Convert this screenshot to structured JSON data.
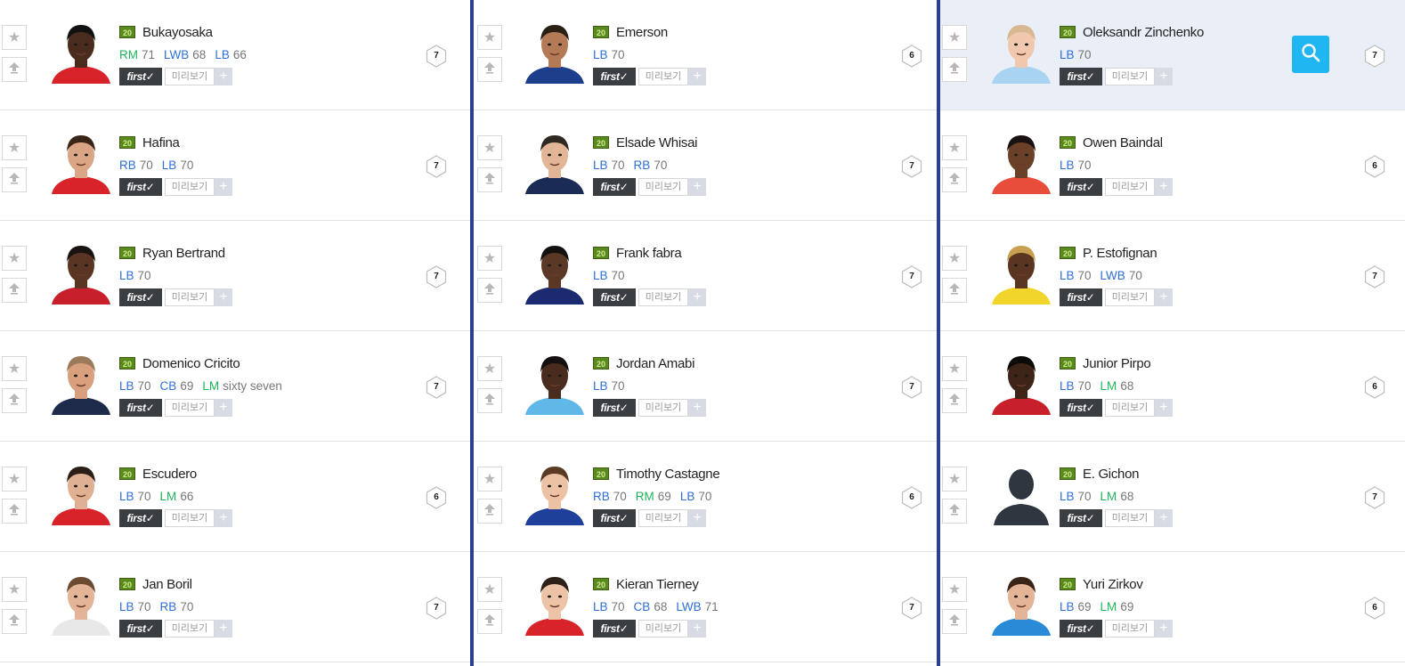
{
  "ui": {
    "season_label": "20",
    "first_label": "first✓",
    "preview_label": "미리보기",
    "plus_label": "+",
    "star_glyph": "★"
  },
  "colors": {
    "divider": "#2b3f8f",
    "highlight_bg": "#e9eef7",
    "search_button": "#1fb6f2",
    "position_blue": "#2f6fd6",
    "position_green": "#1eb35a"
  },
  "columns": [
    {
      "players": [
        {
          "name": "Bukayosaka",
          "grade": "7",
          "positions": [
            {
              "pos": "RM",
              "color": "green",
              "ovr": "71"
            },
            {
              "pos": "LWB",
              "color": "blue",
              "ovr": "68"
            },
            {
              "pos": "LB",
              "color": "blue",
              "ovr": "66"
            }
          ],
          "face": {
            "skin": "#4a2c1c",
            "hair": "#111",
            "shirt": "#d9232a",
            "bg": "#fff"
          }
        },
        {
          "name": "Hafina",
          "grade": "7",
          "positions": [
            {
              "pos": "RB",
              "color": "blue",
              "ovr": "70"
            },
            {
              "pos": "LB",
              "color": "blue",
              "ovr": "70"
            }
          ],
          "face": {
            "skin": "#d9a585",
            "hair": "#3a2418",
            "shirt": "#d9232a",
            "bg": "#fff"
          }
        },
        {
          "name": "Ryan Bertrand",
          "grade": "7",
          "positions": [
            {
              "pos": "LB",
              "color": "blue",
              "ovr": "70"
            }
          ],
          "face": {
            "skin": "#5a3524",
            "hair": "#1a1210",
            "shirt": "#c8202a",
            "bg": "#fff"
          }
        },
        {
          "name": "Domenico Cricito",
          "grade": "7",
          "positions": [
            {
              "pos": "LB",
              "color": "blue",
              "ovr": "70"
            },
            {
              "pos": "CB",
              "color": "blue",
              "ovr": "69"
            },
            {
              "pos": "LM",
              "color": "green",
              "ovr": "sixty seven"
            }
          ],
          "face": {
            "skin": "#d8a07c",
            "hair": "#9a7a5a",
            "shirt": "#1e2a4a",
            "bg": "#fff"
          }
        },
        {
          "name": "Escudero",
          "grade": "6",
          "positions": [
            {
              "pos": "LB",
              "color": "blue",
              "ovr": "70"
            },
            {
              "pos": "LM",
              "color": "green",
              "ovr": "66"
            }
          ],
          "face": {
            "skin": "#e0b093",
            "hair": "#2a1e16",
            "shirt": "#d9232a",
            "bg": "#fff"
          }
        },
        {
          "name": "Jan Boril",
          "grade": "7",
          "positions": [
            {
              "pos": "LB",
              "color": "blue",
              "ovr": "70"
            },
            {
              "pos": "RB",
              "color": "blue",
              "ovr": "70"
            }
          ],
          "face": {
            "skin": "#e3b596",
            "hair": "#6b4a32",
            "shirt": "#e8e8e8",
            "bg": "#fff"
          }
        }
      ]
    },
    {
      "players": [
        {
          "name": "Emerson",
          "grade": "6",
          "positions": [
            {
              "pos": "LB",
              "color": "blue",
              "ovr": "70"
            }
          ],
          "face": {
            "skin": "#b47a55",
            "hair": "#2b2016",
            "shirt": "#1d3e8a",
            "bg": "#fff"
          }
        },
        {
          "name": "Elsade Whisai",
          "grade": "7",
          "positions": [
            {
              "pos": "LB",
              "color": "blue",
              "ovr": "70"
            },
            {
              "pos": "RB",
              "color": "blue",
              "ovr": "70"
            }
          ],
          "face": {
            "skin": "#e2b597",
            "hair": "#2f2922",
            "shirt": "#1a2b55",
            "bg": "#fff"
          }
        },
        {
          "name": "Frank fabra",
          "grade": "7",
          "positions": [
            {
              "pos": "LB",
              "color": "blue",
              "ovr": "70"
            }
          ],
          "face": {
            "skin": "#5b3826",
            "hair": "#141010",
            "shirt": "#1a2b70",
            "bg": "#fff"
          }
        },
        {
          "name": "Jordan Amabi",
          "grade": "7",
          "positions": [
            {
              "pos": "LB",
              "color": "blue",
              "ovr": "70"
            }
          ],
          "face": {
            "skin": "#4a2c1e",
            "hair": "#141010",
            "shirt": "#5fb8e8",
            "bg": "#fff"
          }
        },
        {
          "name": "Timothy Castagne",
          "grade": "6",
          "positions": [
            {
              "pos": "RB",
              "color": "blue",
              "ovr": "70"
            },
            {
              "pos": "RM",
              "color": "green",
              "ovr": "69"
            },
            {
              "pos": "LB",
              "color": "blue",
              "ovr": "70"
            }
          ],
          "face": {
            "skin": "#ecc2a5",
            "hair": "#5a3a22",
            "shirt": "#1e3f9a",
            "bg": "#fff"
          }
        },
        {
          "name": "Kieran Tierney",
          "grade": "7",
          "positions": [
            {
              "pos": "LB",
              "color": "blue",
              "ovr": "70"
            },
            {
              "pos": "CB",
              "color": "blue",
              "ovr": "68"
            },
            {
              "pos": "LWB",
              "color": "blue",
              "ovr": "71"
            }
          ],
          "face": {
            "skin": "#ecc3a6",
            "hair": "#2e2018",
            "shirt": "#d9232a",
            "bg": "#fff"
          }
        }
      ]
    },
    {
      "players": [
        {
          "name": "Oleksandr Zinchenko",
          "grade": "7",
          "highlight": true,
          "positions": [
            {
              "pos": "LB",
              "color": "blue",
              "ovr": "70"
            }
          ],
          "face": {
            "skin": "#f0c8ad",
            "hair": "#d8b890",
            "shirt": "#a8d4f2",
            "bg": "#e9eef7"
          }
        },
        {
          "name": "Owen Baindal",
          "grade": "6",
          "positions": [
            {
              "pos": "LB",
              "color": "blue",
              "ovr": "70"
            }
          ],
          "face": {
            "skin": "#6b4028",
            "hair": "#1a1210",
            "shirt": "#e84c3a",
            "bg": "#fff"
          }
        },
        {
          "name": "P. Estofignan",
          "grade": "7",
          "positions": [
            {
              "pos": "LB",
              "color": "blue",
              "ovr": "70"
            },
            {
              "pos": "LWB",
              "color": "blue",
              "ovr": "70"
            }
          ],
          "face": {
            "skin": "#5a3522",
            "hair": "#c9a050",
            "shirt": "#f2d52a",
            "bg": "#fff"
          }
        },
        {
          "name": "Junior Pirpo",
          "grade": "6",
          "positions": [
            {
              "pos": "LB",
              "color": "blue",
              "ovr": "70"
            },
            {
              "pos": "LM",
              "color": "green",
              "ovr": "68"
            }
          ],
          "face": {
            "skin": "#3e2418",
            "hair": "#0e0a08",
            "shirt": "#c8202a",
            "bg": "#fff"
          }
        },
        {
          "name": "E. Gichon",
          "grade": "7",
          "silhouette": true,
          "positions": [
            {
              "pos": "LB",
              "color": "blue",
              "ovr": "70"
            },
            {
              "pos": "LM",
              "color": "green",
              "ovr": "68"
            }
          ],
          "face": {
            "skin": "#2f3640",
            "hair": "#2f3640",
            "shirt": "#2f3640",
            "bg": "#fff"
          }
        },
        {
          "name": "Yuri Zirkov",
          "grade": "6",
          "positions": [
            {
              "pos": "LB",
              "color": "blue",
              "ovr": "69"
            },
            {
              "pos": "LM",
              "color": "green",
              "ovr": "69"
            }
          ],
          "face": {
            "skin": "#e3b596",
            "hair": "#3a2418",
            "shirt": "#2a8ad8",
            "bg": "#fff"
          }
        }
      ]
    }
  ]
}
